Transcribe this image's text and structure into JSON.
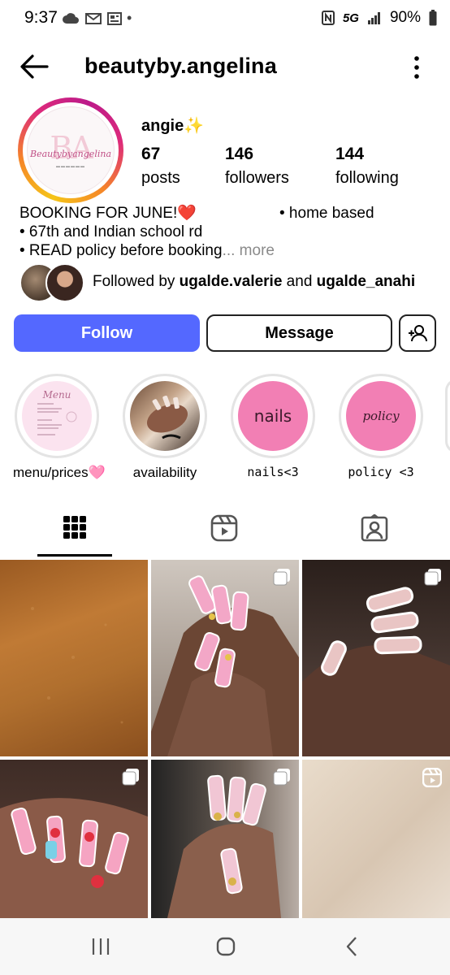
{
  "status_bar": {
    "time": "9:37",
    "network": "5G",
    "battery": "90%"
  },
  "header": {
    "username": "beautyby.angelina"
  },
  "profile": {
    "display_name": "angie✨",
    "avatar_logo": {
      "monogram": "BA",
      "script": "Beautybyangelina"
    },
    "stats": [
      {
        "num": "67",
        "label": "posts"
      },
      {
        "num": "146",
        "label": "followers"
      },
      {
        "num": "144",
        "label": "following"
      }
    ]
  },
  "bio": {
    "line1": "BOOKING FOR JUNE!❤️",
    "line1b": "• home based",
    "line2": "• 67th and Indian school rd",
    "line3": "• READ policy before booking",
    "more": "... more"
  },
  "followed_by": {
    "prefix": "Followed by ",
    "user1": "ugalde.valerie",
    "joiner": " and ",
    "user2": "ugalde_anahi"
  },
  "actions": {
    "follow": "Follow",
    "message": "Message"
  },
  "highlights": [
    {
      "label": "menu/prices🩷",
      "inner_text": "Menu"
    },
    {
      "label": "availability",
      "inner_text": ""
    },
    {
      "label": "nails<3",
      "inner_text": "nails"
    },
    {
      "label": "policy <3",
      "inner_text": "policy"
    }
  ],
  "tabs": [
    {
      "name": "grid",
      "icon": "grid-icon",
      "selected": true
    },
    {
      "name": "reels",
      "icon": "reels-icon",
      "selected": false
    },
    {
      "name": "tagged",
      "icon": "tagged-icon",
      "selected": false
    }
  ],
  "colors": {
    "follow_button": "#5468ff",
    "highlight_pink": "#f27fb4"
  }
}
